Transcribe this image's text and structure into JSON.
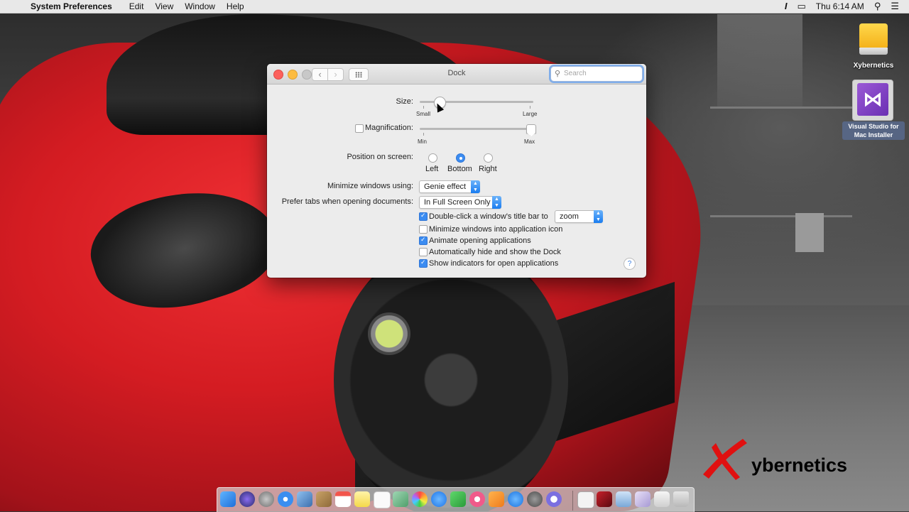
{
  "menubar": {
    "app_name": "System Preferences",
    "menus": [
      "Edit",
      "View",
      "Window",
      "Help"
    ],
    "clock": "Thu 6:14 AM"
  },
  "desktop": {
    "drive_label": "Xybernetics",
    "installer_label": "Visual Studio for Mac Installer",
    "watermark": "ybernetics"
  },
  "window": {
    "title": "Dock",
    "search_placeholder": "Search"
  },
  "dock_prefs": {
    "size": {
      "label": "Size:",
      "min_label": "Small",
      "max_label": "Large",
      "value": 0.17
    },
    "magnification": {
      "label": "Magnification:",
      "checked": false,
      "min_label": "Min",
      "max_label": "Max",
      "value": 0.98
    },
    "position": {
      "label": "Position on screen:",
      "options": [
        "Left",
        "Bottom",
        "Right"
      ],
      "selected": "Bottom"
    },
    "minimize": {
      "label": "Minimize windows using:",
      "value": "Genie effect"
    },
    "prefer_tabs": {
      "label": "Prefer tabs when opening documents:",
      "value": "In Full Screen Only"
    },
    "double_click": {
      "label": "Double-click a window's title bar to",
      "checked": true,
      "value": "zoom"
    },
    "checkboxes": [
      {
        "label": "Minimize windows into application icon",
        "checked": false
      },
      {
        "label": "Animate opening applications",
        "checked": true
      },
      {
        "label": "Automatically hide and show the Dock",
        "checked": false
      },
      {
        "label": "Show indicators for open applications",
        "checked": true
      }
    ],
    "help": "?"
  }
}
